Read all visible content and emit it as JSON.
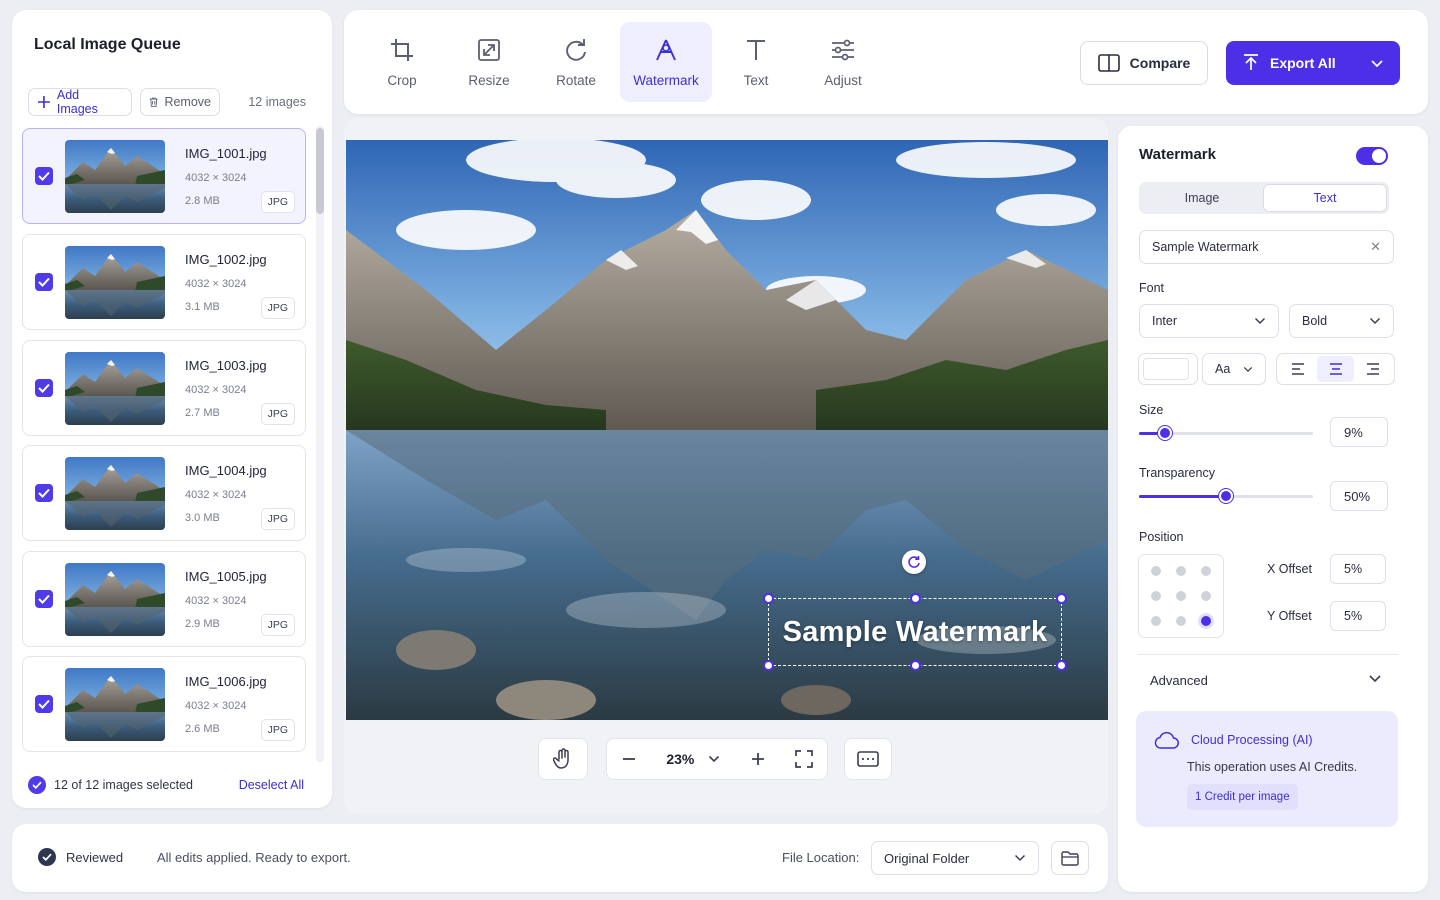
{
  "queue": {
    "title": "Local Image Queue",
    "add_label": "Add Images",
    "remove_label": "Remove",
    "count_label": "12 images",
    "items": [
      {
        "name": "IMG_1001.jpg",
        "dims": "4032 × 3024",
        "size": "2.8 MB",
        "type": "JPG",
        "checked": true,
        "selected": true
      },
      {
        "name": "IMG_1002.jpg",
        "dims": "4032 × 3024",
        "size": "3.1 MB",
        "type": "JPG",
        "checked": true,
        "selected": false
      },
      {
        "name": "IMG_1003.jpg",
        "dims": "4032 × 3024",
        "size": "2.7 MB",
        "type": "JPG",
        "checked": true,
        "selected": false
      },
      {
        "name": "IMG_1004.jpg",
        "dims": "4032 × 3024",
        "size": "3.0 MB",
        "type": "JPG",
        "checked": true,
        "selected": false
      },
      {
        "name": "IMG_1005.jpg",
        "dims": "4032 × 3024",
        "size": "2.9 MB",
        "type": "JPG",
        "checked": true,
        "selected": false
      },
      {
        "name": "IMG_1006.jpg",
        "dims": "4032 × 3024",
        "size": "2.6 MB",
        "type": "JPG",
        "checked": true,
        "selected": false
      }
    ],
    "selection_text": "12 of 12 images selected",
    "deselect_label": "Deselect All"
  },
  "toolbar": {
    "tools": [
      {
        "label": "Crop",
        "icon": "crop-icon",
        "active": false
      },
      {
        "label": "Resize",
        "icon": "resize-icon",
        "active": false
      },
      {
        "label": "Rotate",
        "icon": "rotate-icon",
        "active": false
      },
      {
        "label": "Watermark",
        "icon": "watermark-icon",
        "active": true
      },
      {
        "label": "Text",
        "icon": "text-icon",
        "active": false
      },
      {
        "label": "Adjust",
        "icon": "sliders-icon",
        "active": false
      }
    ],
    "compare_label": "Compare",
    "export_label": "Export All"
  },
  "canvas": {
    "watermark_text": "Sample Watermark",
    "zoom": "23%"
  },
  "settings": {
    "title": "Watermark",
    "enabled": true,
    "tabs": [
      "Image",
      "Text"
    ],
    "active_tab": "Text",
    "text_value": "Sample Watermark",
    "font_label": "Font",
    "font_family": "Inter",
    "font_weight": "Bold",
    "case_label": "Aa",
    "alignment": "center",
    "size_label": "Size",
    "size_value": "9%",
    "size_fraction": 0.09,
    "transparency_label": "Transparency",
    "transparency_value": "50%",
    "transparency_fraction": 0.5,
    "position_label": "Position",
    "position_selected": "bottom-right",
    "x_offset_label": "X Offset",
    "x_offset_value": "5%",
    "y_offset_label": "Y Offset",
    "y_offset_value": "5%",
    "advanced_label": "Advanced",
    "ai_title": "Cloud Processing (AI)",
    "ai_desc": "This operation uses AI Credits.",
    "ai_credit": "1 Credit per image"
  },
  "status": {
    "reviewed_label": "Reviewed",
    "message": "All edits applied. Ready to export.",
    "file_location_label": "File Location:",
    "file_location_value": "Original Folder"
  },
  "colors": {
    "accent": "#4c2fe6",
    "accent_soft": "#efeefe"
  }
}
